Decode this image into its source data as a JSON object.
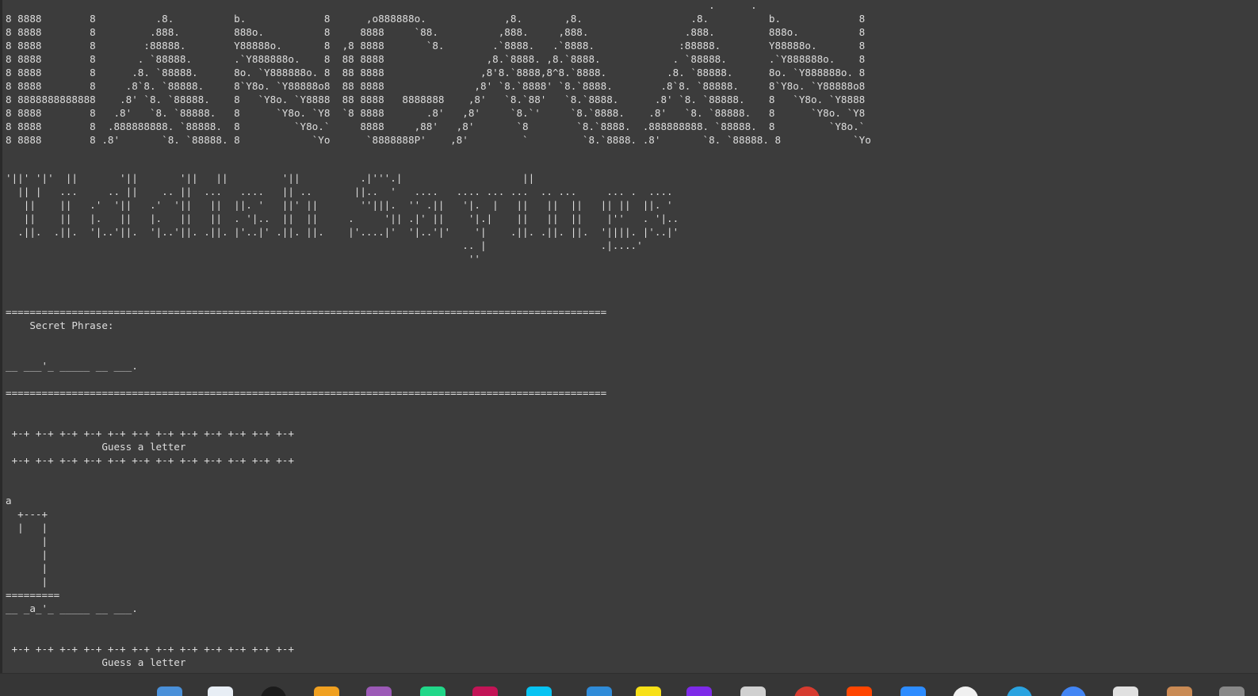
{
  "terminal": {
    "banner_art": "                                                                                                                     .      .\n8 8888        8          .8.          b.             8      ,o888888o.             ,8.       ,8.                  .8.          b.             8\n8 8888        8         .888.         888o.          8     8888     `88.          ,888.     ,888.                .888.         888o.          8\n8 8888        8        :88888.        Y88888o.       8  ,8 8888       `8.        .`8888.   .`8888.              :88888.        Y88888o.       8\n8 8888        8       . `88888.       .`Y888888o.    8  88 8888                 ,8.`8888. ,8.`8888.            . `88888.       .`Y888888o.    8\n8 8888        8      .8. `88888.      8o. `Y888888o. 8  88 8888                ,8'8.`8888,8^8.`8888.          .8. `88888.      8o. `Y888888o. 8\n8 8888        8     .8`8. `88888.     8`Y8o. `Y88888o8  88 8888               ,8' `8.`8888' `8.`8888.        .8`8. `88888.     8`Y8o. `Y88888o8\n8 8888888888888    .8' `8. `88888.    8   `Y8o. `Y8888  88 8888   8888888    ,8'   `8.`88'   `8.`8888.      .8' `8. `88888.    8   `Y8o. `Y8888\n8 8888        8   .8'   `8. `88888.   8      `Y8o. `Y8  `8 8888       .8'   ,8'     `8.`'     `8.`8888.    .8'   `8. `88888.   8      `Y8o. `Y8\n8 8888        8  .888888888. `88888.  8         `Y8o.`     8888     ,88'   ,8'       `8        `8.`8888.  .888888888. `88888.  8         `Y8o.`\n8 8888        8 .8'       `8. `88888. 8            `Yo      `8888888P'    ,8'         `         `8.`8888. .8'       `8. `88888. 8            `Yo",
    "subtitle_art": "'||' '|'  ||       '||       '||   ||         '||          .|'''.|                    ||\n  || |   ...     .. ||    .. ||  ...   ....   || ..       ||..  '   ....   .... ... ...  .. ...     ... .  ....\n   ||    ||   .'  '||   .'  '||   ||  ||. '   ||' ||       ''|||.  '' .||   '|.  |   ||   ||  ||   || ||  ||. '\n   ||    ||   |.   ||   |.   ||   ||  . '|..  ||  ||     .     '|| .|' ||    '|.|    ||   ||  ||    |''   . '|..\n  .||.  .||.  '|..'||.  '|..'||. .||. |'..|' .||. ||.    |'....|'  '|..'|'    '|    .||. .||. ||.  '||||. |'..|'\n                                                                            .. |                   .|....'\n                                                                             ''",
    "game_output": "====================================================================================================\n    Secret Phrase:\n\n\n__ ___'_ _____ __ ___.\n\n====================================================================================================\n\n\n +-+ +-+ +-+ +-+ +-+ +-+ +-+ +-+ +-+ +-+ +-+ +-+\n                Guess a letter\n +-+ +-+ +-+ +-+ +-+ +-+ +-+ +-+ +-+ +-+ +-+ +-+\n\n\na\n  +---+\n  |   |\n      |\n      |\n      |\n      |\n=========\n__ _a_'_ _____ __ ___.\n\n\n +-+ +-+ +-+ +-+ +-+ +-+ +-+ +-+ +-+ +-+ +-+ +-+\n                Guess a letter\n +-+ +-+ +-+ +-+ +-+ +-+ +-+ +-+ +-+ +-+ +-+ +-+"
  },
  "taskbar": {
    "icons": [
      {
        "name": "file-explorer-icon",
        "color": "#4a90d9"
      },
      {
        "name": "text-editor-icon",
        "color": "#e8eef5"
      },
      {
        "name": "steam-icon",
        "color": "#1b1b1b"
      },
      {
        "name": "pycharm-icon",
        "color": "#f0a020"
      },
      {
        "name": "jupyter-icon",
        "color": "#9b59b6"
      },
      {
        "name": "pycharm-community-icon",
        "color": "#21d789"
      },
      {
        "name": "rider-icon",
        "color": "#c21456"
      },
      {
        "name": "webstorm-icon",
        "color": "#07c3f2"
      },
      {
        "name": "visual-studio-icon",
        "color": "#2f8bd8"
      },
      {
        "name": "sticky-notes-icon",
        "color": "#f7e017"
      },
      {
        "name": "obs-icon",
        "color": "#7d2ae8"
      },
      {
        "name": "mail-icon",
        "color": "#d0d0d0"
      },
      {
        "name": "record-icon",
        "color": "#d63b2f"
      },
      {
        "name": "reddit-icon",
        "color": "#ff4500"
      },
      {
        "name": "zoom-icon",
        "color": "#2d8cff"
      },
      {
        "name": "chatgpt-icon",
        "color": "#f0f0f0"
      },
      {
        "name": "telegram-icon",
        "color": "#2aa3e0"
      },
      {
        "name": "chrome-icon",
        "color": "#4285f4"
      },
      {
        "name": "document-icon",
        "color": "#e0e0e0"
      },
      {
        "name": "clipboard-icon",
        "color": "#c98a54"
      },
      {
        "name": "system-tray-icon",
        "color": "#888888"
      }
    ]
  }
}
